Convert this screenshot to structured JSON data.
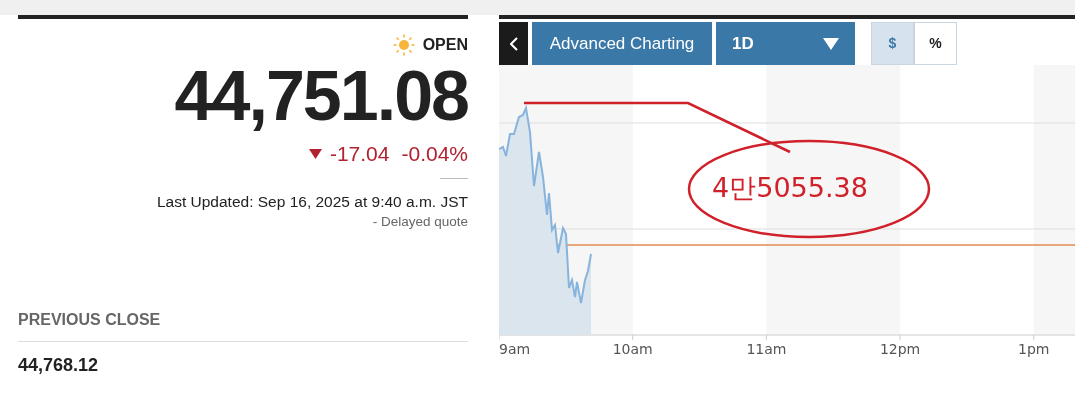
{
  "quote": {
    "market_status": "OPEN",
    "price": "44,751.08",
    "negative": true,
    "change": "-17.04",
    "change_percent": "-0.04%",
    "last_updated": "Last Updated: Sep 16, 2025 at 9:40 a.m. JST",
    "delayed_note": "-  Delayed quote"
  },
  "previous_close": {
    "label": "PREVIOUS CLOSE",
    "value": "44,768.12"
  },
  "chart_toolbar": {
    "advanced_charting": "Advanced Charting",
    "range": "1D",
    "units": [
      {
        "label": "$",
        "selected": true
      },
      {
        "label": "%",
        "selected": false
      }
    ]
  },
  "chart": {
    "x_labels": [
      "9am",
      "10am",
      "11am",
      "12pm",
      "1pm"
    ],
    "annotation": "4만5055.38"
  }
}
